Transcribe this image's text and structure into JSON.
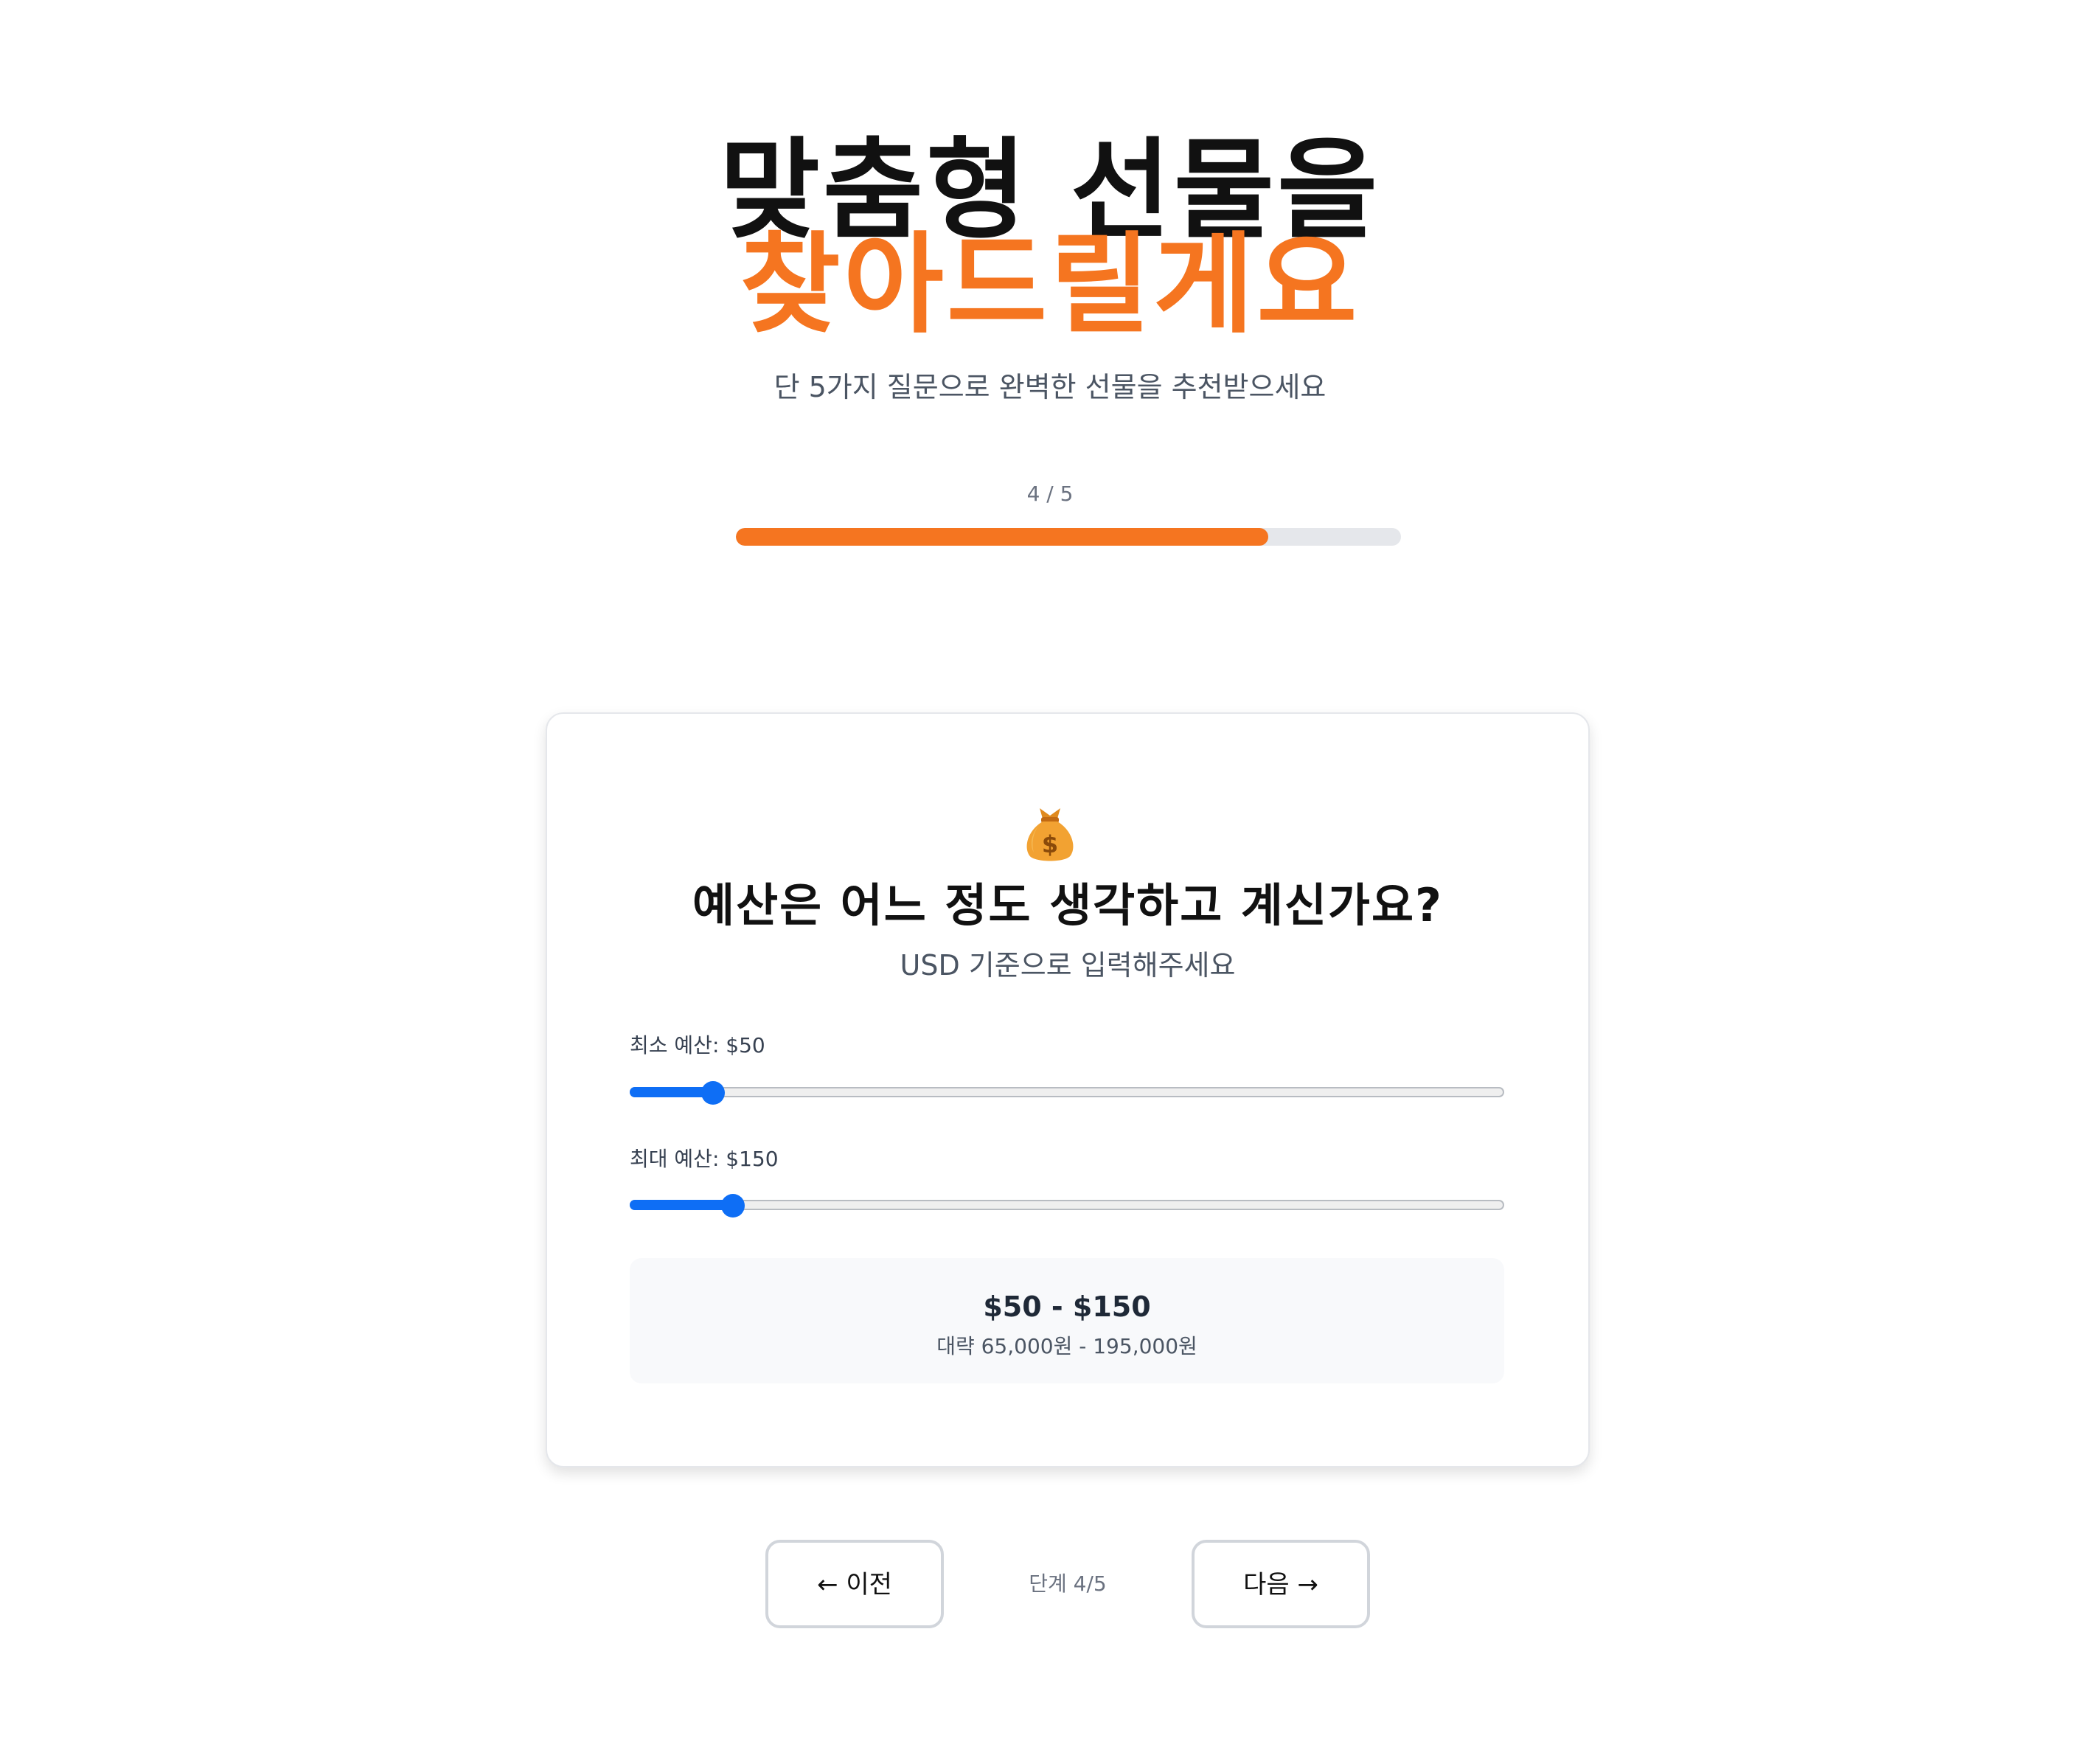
{
  "header": {
    "title_line1": "맞춤형 선물을",
    "title_line2": "찾아드릴게요",
    "subtitle": "단 5가지 질문으로 완벽한 선물을 추천받으세요",
    "accent_color": "#f57520"
  },
  "progress": {
    "text": "4 / 5",
    "current": 4,
    "total": 5,
    "fraction": 0.8
  },
  "question": {
    "icon": "money-bag-icon",
    "title": "예산은 어느 정도 생각하고 계신가요?",
    "subtitle": "USD 기준으로 입력해주세요"
  },
  "sliders": {
    "min": {
      "label": "최소 예산: $50",
      "value": 50,
      "fraction": 0.095
    },
    "max": {
      "label": "최대 예산: $150",
      "value": 150,
      "fraction": 0.118
    },
    "accent_color": "#0e6ef5"
  },
  "range_summary": {
    "usd": "$50 - $150",
    "krw": "대략 65,000원 - 195,000원"
  },
  "navigation": {
    "prev_label": "← 이전",
    "step_text": "단계 4/5",
    "next_label": "다음 →"
  }
}
